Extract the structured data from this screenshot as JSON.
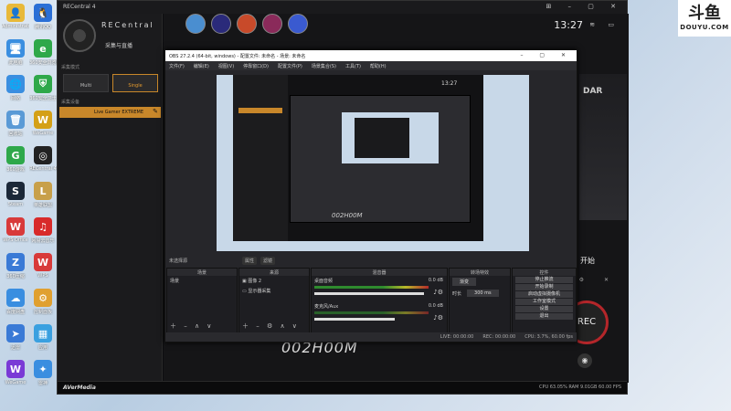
{
  "desktop": {
    "icons": [
      {
        "label": "Administrator",
        "color": "#e8b93a",
        "glyph": "👤"
      },
      {
        "label": "腾讯QQ",
        "color": "#2a6fd6",
        "glyph": "🐧"
      },
      {
        "label": "此电脑",
        "color": "#3a8ee0",
        "glyph": "🖥"
      },
      {
        "label": "360安全浏览器",
        "color": "#2ea84a",
        "glyph": "e"
      },
      {
        "label": "网络",
        "color": "#3a8ee0",
        "glyph": "🌐"
      },
      {
        "label": "360安全卫士",
        "color": "#2ea84a",
        "glyph": "⛨"
      },
      {
        "label": "回收站",
        "color": "#5a9ad6",
        "glyph": "🗑"
      },
      {
        "label": "WeGame",
        "color": "#d4a017",
        "glyph": "W"
      },
      {
        "label": "360游戏",
        "color": "#2ea84a",
        "glyph": "G"
      },
      {
        "label": "RECentral 4",
        "color": "#222",
        "glyph": "◎"
      },
      {
        "label": "Steam",
        "color": "#1b2838",
        "glyph": "S"
      },
      {
        "label": "英雄联盟",
        "color": "#c8a04a",
        "glyph": "L"
      },
      {
        "label": "WPS Office",
        "color": "#d83a3a",
        "glyph": "W"
      },
      {
        "label": "网易云音乐",
        "color": "#d82a2a",
        "glyph": "♫"
      },
      {
        "label": "360压缩",
        "color": "#3a7ad6",
        "glyph": "Z"
      },
      {
        "label": "WPS",
        "color": "#d83a3a",
        "glyph": "W"
      },
      {
        "label": "百度网盘",
        "color": "#3a8ee0",
        "glyph": "☁"
      },
      {
        "label": "控制面板",
        "color": "#e0a030",
        "glyph": "⚙"
      },
      {
        "label": "迅雷",
        "color": "#3a7ad6",
        "glyph": "➤"
      },
      {
        "label": "应用",
        "color": "#3aa0e0",
        "glyph": "▦"
      },
      {
        "label": "WeGame",
        "color": "#7a3ad6",
        "glyph": "W"
      },
      {
        "label": "雷神",
        "color": "#3a8ee0",
        "glyph": "✦"
      }
    ]
  },
  "douyu": {
    "cn": "斗鱼",
    "en": "DOUYU.COM"
  },
  "recentral": {
    "window_title": "RECentral 4",
    "brand": "RECentral",
    "subtitle": "采集与直播",
    "mode_label": "采集模式",
    "modes": [
      {
        "label": "Multi"
      },
      {
        "label": "Single"
      }
    ],
    "device_label": "采集设备",
    "device": "Live Gamer EXTREME",
    "clock": "13:27",
    "side_text": "DAR",
    "start_label": "开始",
    "rec_label": "REC",
    "timer": "002H00M",
    "footer_brand": "AVerMedia",
    "footer_stats": "CPU 63.05%  RAM 9.01GB  60.00 FPS"
  },
  "obs": {
    "title": "OBS 27.2.4 (64-bit, windows) - 配置文件: 未命名 - 场景: 未命名",
    "menu": [
      "文件(F)",
      "编辑(E)",
      "视图(V)",
      "停靠窗口(D)",
      "配置文件(P)",
      "场景集合(S)",
      "工具(T)",
      "帮助(H)"
    ],
    "no_source": "未选择源",
    "subtabs": [
      "属性",
      "滤镜"
    ],
    "nested_clock": "13:27",
    "nested_timer": "002H00M",
    "docks": {
      "scenes": {
        "title": "场景",
        "items": [
          "场景"
        ]
      },
      "sources": {
        "title": "来源",
        "items": [
          "图像 2",
          "显示器采集"
        ]
      },
      "mixer": {
        "title": "混音器",
        "channels": [
          {
            "name": "桌面音频",
            "db": "0.0 dB"
          },
          {
            "name": "麦克风/Aux",
            "db": "0.0 dB"
          }
        ]
      },
      "transitions": {
        "title": "转场特效",
        "type": "渐变",
        "duration_label": "时长",
        "duration": "300 ms"
      },
      "controls": {
        "title": "控件",
        "buttons": [
          "停止推流",
          "开始录制",
          "启动虚拟摄像机",
          "工作室模式",
          "设置",
          "退出"
        ]
      }
    },
    "status": [
      "LIVE: 00:00:00",
      "REC: 00:00:00",
      "CPU: 3.7%, 60.00 fps"
    ]
  }
}
